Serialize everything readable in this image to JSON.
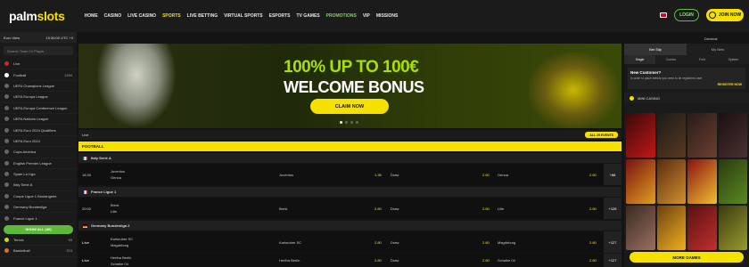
{
  "brand": {
    "logo_main": "palm",
    "logo_accent": "slots"
  },
  "nav": [
    {
      "label": "HOME"
    },
    {
      "label": "CASINO"
    },
    {
      "label": "LIVE CASINO"
    },
    {
      "label": "SPORTS",
      "active": true
    },
    {
      "label": "LIVE BETTING"
    },
    {
      "label": "VIRTUAL SPORTS"
    },
    {
      "label": "ESPORTS"
    },
    {
      "label": "TV GAMES"
    },
    {
      "label": "PROMOTIONS"
    },
    {
      "label": "VIP"
    },
    {
      "label": "MISSIONS"
    }
  ],
  "header": {
    "login": "LOGIN",
    "join": "JOIN NOW"
  },
  "sidebar": {
    "view": "Euro View",
    "time": "15:30:00 UTC +3",
    "search_placeholder": "Search Team Or Player",
    "items": [
      {
        "label": "Live",
        "count": ""
      },
      {
        "label": "Football",
        "count": "1294"
      },
      {
        "label": "UEFA Champions League",
        "count": ""
      },
      {
        "label": "UEFA Europa League",
        "count": ""
      },
      {
        "label": "UEFA Europa Conference League",
        "count": ""
      },
      {
        "label": "UEFA Nations League",
        "count": ""
      },
      {
        "label": "UEFA Euro 2024 Qualifiers",
        "count": ""
      },
      {
        "label": "UEFA Euro 2024",
        "count": ""
      },
      {
        "label": "Copa America",
        "count": ""
      },
      {
        "label": "English Premier League",
        "count": ""
      },
      {
        "label": "Spain La Liga",
        "count": ""
      },
      {
        "label": "Italy Serie A",
        "count": ""
      },
      {
        "label": "Coupe Ligue 1 Boulangerie",
        "count": ""
      },
      {
        "label": "Germany Bundesliga",
        "count": ""
      },
      {
        "label": "France Ligue 1",
        "count": ""
      }
    ],
    "show_all": "SHOW ALL (40)",
    "bottom": [
      {
        "label": "Tennis",
        "count": "93"
      },
      {
        "label": "Basketball",
        "count": "374"
      }
    ]
  },
  "banner": {
    "line1": "100% UP TO 100€",
    "line2": "WELCOME BONUS",
    "cta": "CLAIM NOW"
  },
  "events": {
    "live_label": "Live",
    "all_events": "ALL 29 EVENTS",
    "sport": "FOOTBALL",
    "leagues": [
      {
        "name": "Italy Serie A",
        "matches": [
          {
            "time": "18:30",
            "home": "Juventus",
            "away": "Genoa",
            "o1_label": "Juventus",
            "o1": "1.36",
            "ox_label": "Draw",
            "ox": "2.60",
            "o2_label": "Genoa",
            "o2": "2.60",
            "more": "+88"
          }
        ]
      },
      {
        "name": "France Ligue 1",
        "matches": [
          {
            "time": "20:00",
            "home": "Brest",
            "away": "Lille",
            "o1_label": "Brest",
            "o1": "2.80",
            "ox_label": "Draw",
            "ox": "2.80",
            "o2_label": "Lille",
            "o2": "2.80",
            "more": "+128"
          }
        ]
      },
      {
        "name": "Germany Bundesliga 2",
        "matches": [
          {
            "time": "Live",
            "home": "Karlsruher SC",
            "away": "Magdeburg",
            "o1_label": "Karlsruher SC",
            "o1": "2.80",
            "ox_label": "Draw",
            "ox": "2.80",
            "o2_label": "Magdeburg",
            "o2": "2.80",
            "more": "+127"
          },
          {
            "time": "Live",
            "home": "Hertha Berlin",
            "away": "Schalke 04",
            "o1_label": "Hertha Berlin",
            "o1": "2.80",
            "ox_label": "Draw",
            "ox": "2.80",
            "o2_label": "Schalke 04",
            "o2": "2.80",
            "more": "+127"
          }
        ]
      }
    ]
  },
  "betslip": {
    "tabs": [
      "Bet Slip",
      "My Bets"
    ],
    "subtabs": [
      "Single",
      "Combo",
      "Fold",
      "System"
    ],
    "odds_format": "Decimal",
    "new_customer_title": "New Customer?",
    "new_customer_text": "In order to place bets/to you need to be registered user",
    "register": "REGISTER NOW",
    "mini_casino": "MINI CASINO",
    "more_games": "MORE GAMES"
  },
  "colors": {
    "accent": "#f5e000",
    "green": "#5fb83a"
  }
}
